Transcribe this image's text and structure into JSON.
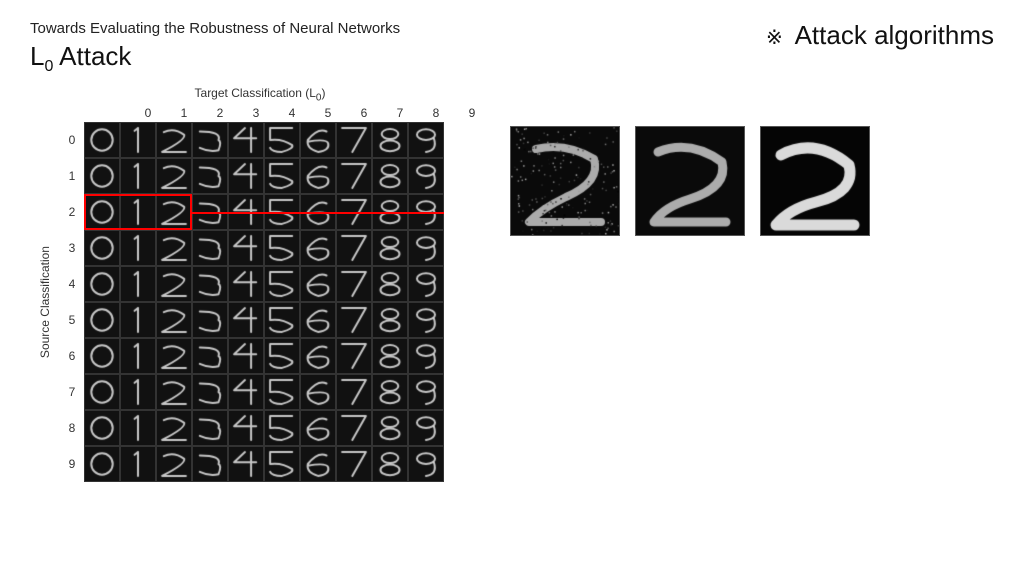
{
  "page": {
    "title": "Towards Evaluating the Robustness of Neural Networks",
    "attack_title_prefix": "L",
    "attack_title_sub": "0",
    "attack_title_suffix": " Attack",
    "right_header_symbol": "※",
    "right_header_text": "Attack algorithms",
    "target_label": "Target Classification (L",
    "target_label_sub": "0",
    "target_label_suffix": ")",
    "source_label": "Source Classification",
    "col_numbers": [
      "0",
      "1",
      "2",
      "3",
      "4",
      "5",
      "6",
      "7",
      "8",
      "9"
    ],
    "row_numbers": [
      "0",
      "1",
      "2",
      "3",
      "4",
      "5",
      "6",
      "7",
      "8",
      "9"
    ]
  }
}
